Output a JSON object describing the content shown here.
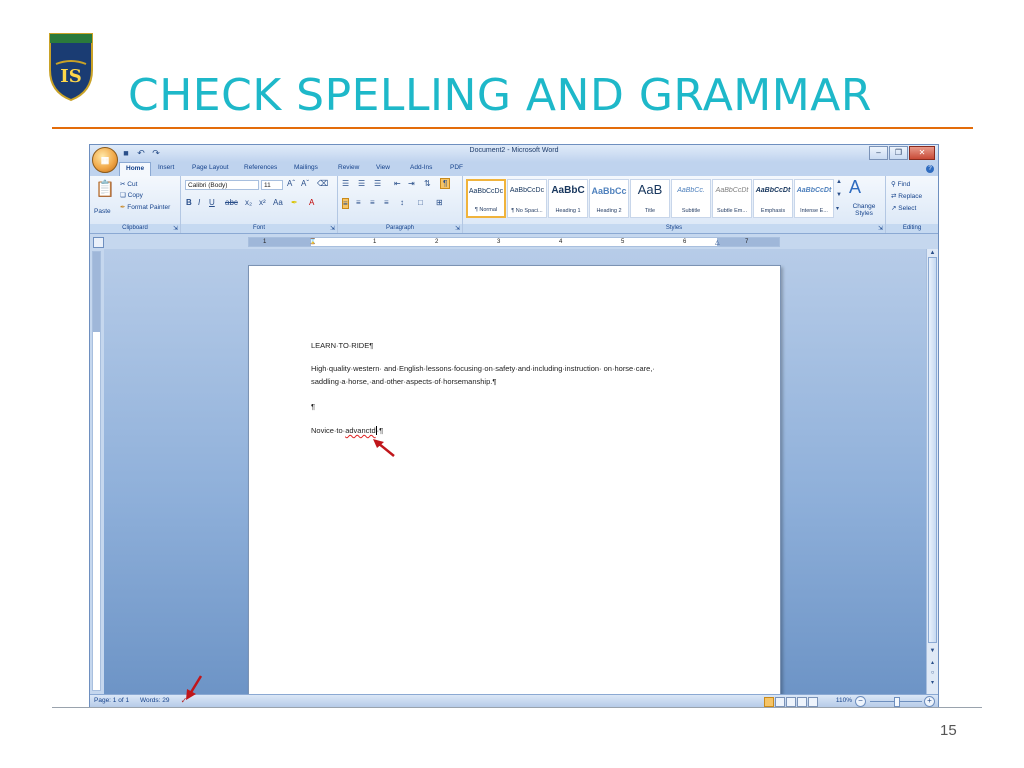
{
  "slide": {
    "title": "CHECK SPELLING AND GRAMMAR",
    "number": "15",
    "logo_text": "IS",
    "colors": {
      "title": "#1eb8c9",
      "rule": "#e36c0a",
      "arrow": "#c0161b"
    }
  },
  "window": {
    "title": "Document2 - Microsoft Word",
    "quick_access": [
      "save-icon",
      "undo-icon",
      "redo-icon"
    ],
    "controls": [
      "minimize",
      "restore",
      "close"
    ]
  },
  "ribbon": {
    "tabs": [
      {
        "label": "Home",
        "active": true
      },
      {
        "label": "Insert"
      },
      {
        "label": "Page Layout"
      },
      {
        "label": "References"
      },
      {
        "label": "Mailings"
      },
      {
        "label": "Review"
      },
      {
        "label": "View"
      },
      {
        "label": "Add-Ins"
      },
      {
        "label": "PDF"
      }
    ],
    "clipboard": {
      "label": "Clipboard",
      "paste": "Paste",
      "cut": "Cut",
      "copy": "Copy",
      "format_painter": "Format Painter"
    },
    "font": {
      "label": "Font",
      "name": "Calibri (Body)",
      "size": "11"
    },
    "paragraph": {
      "label": "Paragraph"
    },
    "styles": {
      "label": "Styles",
      "items": [
        {
          "sample": "AaBbCcDc",
          "name": "¶ Normal",
          "selected": true
        },
        {
          "sample": "AaBbCcDc",
          "name": "¶ No Spaci..."
        },
        {
          "sample": "AaBbC",
          "name": "Heading 1"
        },
        {
          "sample": "AaBbCc",
          "name": "Heading 2"
        },
        {
          "sample": "AaB",
          "name": "Title"
        },
        {
          "sample": "AaBbCc.",
          "name": "Subtitle"
        },
        {
          "sample": "AaBbCcDt",
          "name": "Subtle Em..."
        },
        {
          "sample": "AaBbCcDt",
          "name": "Emphasis"
        },
        {
          "sample": "AaBbCcDt",
          "name": "Intense E..."
        }
      ],
      "change_styles": "Change Styles"
    },
    "editing": {
      "label": "Editing",
      "find": "Find",
      "replace": "Replace",
      "select": "Select"
    }
  },
  "ruler": {
    "numbers": [
      "1",
      "1",
      "2",
      "3",
      "4",
      "5",
      "6",
      "7"
    ]
  },
  "document": {
    "line1": "LEARN·TO·RIDE¶",
    "line2": "High·quality·western· and·English·lessons·focusing·on·safety·and·including·instruction· on·horse·care,·",
    "line3": "saddling·a·horse,·and·other·aspects·of·horsemanship.¶",
    "line4": "¶",
    "line5_before": "Novice·to·",
    "line5_misspelled": "advanctd",
    "line5_after": "·¶"
  },
  "status": {
    "page": "Page: 1 of 1",
    "words": "Words: 29",
    "zoom": "110%"
  }
}
